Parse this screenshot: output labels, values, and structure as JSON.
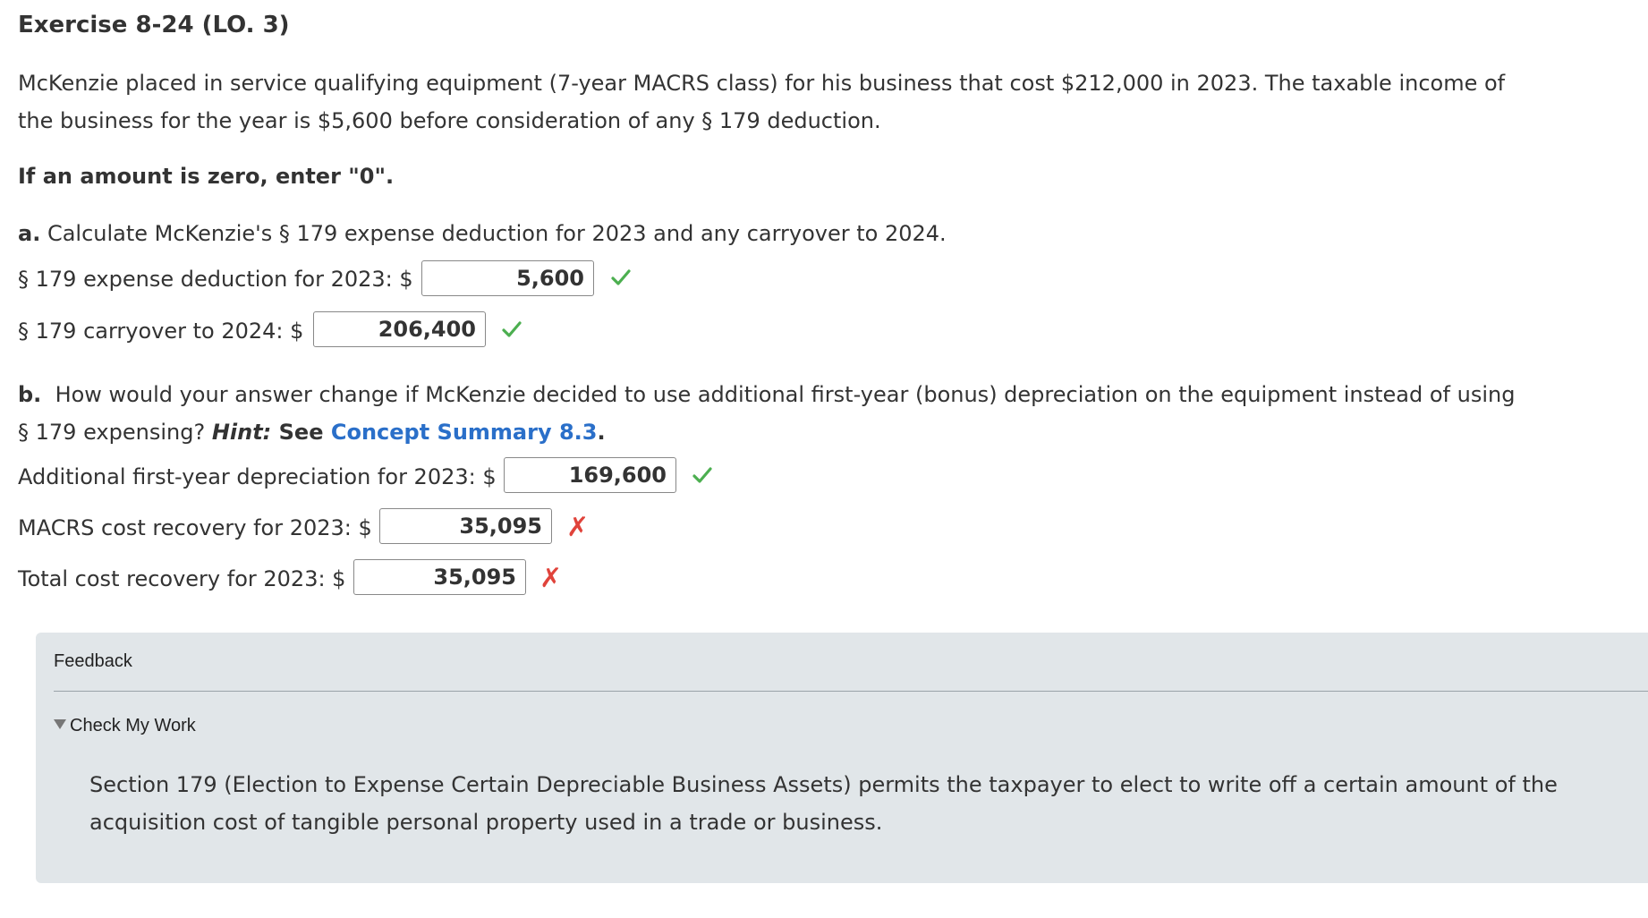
{
  "title": "Exercise 8-24 (LO. 3)",
  "intro": {
    "line1": "McKenzie placed in service qualifying equipment (7-year MACRS class) for his business that cost $212,000 in 2023. The taxable income of",
    "line2": "the business for the year is $5,600 before consideration of any § 179 deduction."
  },
  "zero_note": "If an amount is zero, enter \"0\".",
  "part_a": {
    "letter": "a.",
    "question": "Calculate McKenzie's § 179 expense deduction for 2023 and any carryover to 2024.",
    "rows": [
      {
        "label": "§ 179 expense deduction for 2023: $",
        "value": "5,600",
        "status": "correct"
      },
      {
        "label": "§ 179 carryover to 2024: $",
        "value": "206,400",
        "status": "correct"
      }
    ]
  },
  "part_b": {
    "letter": "b.",
    "question_line1": "How would your answer change if McKenzie decided to use additional first-year (bonus) depreciation on the equipment instead of using",
    "question_line2_start": "§ 179 expensing? ",
    "hint_label": "Hint:",
    "hint_see": " See ",
    "hint_link": "Concept Summary 8.3",
    "hint_end": ".",
    "rows": [
      {
        "label": "Additional first-year depreciation for 2023: $",
        "value": "169,600",
        "status": "correct"
      },
      {
        "label": "MACRS cost recovery for 2023: $",
        "value": "35,095",
        "status": "incorrect"
      },
      {
        "label": "Total cost recovery for 2023: $",
        "value": "35,095",
        "status": "incorrect"
      }
    ]
  },
  "feedback": {
    "title": "Feedback",
    "toggle_label": "Check My Work",
    "body": "Section 179 (Election to Expense Certain Depreciable Business Assets) permits the taxpayer to elect to write off a certain amount of the acquisition cost of tangible personal property used in a trade or business."
  },
  "colors": {
    "correct": "#4caf50",
    "incorrect": "#e0433b",
    "link": "#2a6fc9",
    "panel": "#e1e6e9"
  },
  "icons": {
    "correct": "check-icon",
    "incorrect": "x-icon",
    "toggle": "triangle-down-icon"
  }
}
